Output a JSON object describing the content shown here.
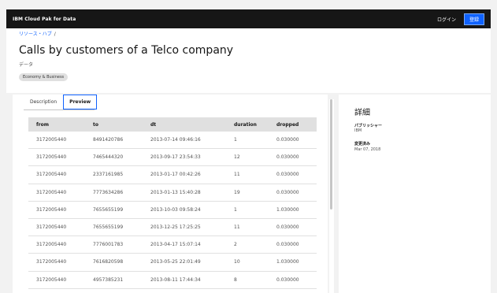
{
  "header": {
    "brand": "IBM Cloud Pak for Data",
    "login": "ログイン",
    "register": "登録"
  },
  "breadcrumb": {
    "hub": "リソース・ハブ",
    "separator": "/"
  },
  "asset": {
    "title": "Calls by customers of a Telco company",
    "type": "データ",
    "tag": "Economy & Business"
  },
  "tabs": [
    {
      "label": "Description",
      "selected": false
    },
    {
      "label": "Preview",
      "selected": true
    }
  ],
  "table": {
    "columns": [
      "from",
      "to",
      "dt",
      "duration",
      "dropped"
    ],
    "rows": [
      [
        "3172005440",
        "8491420786",
        "2013-07-14 09:46:16",
        "1",
        "0.030000"
      ],
      [
        "3172005440",
        "7465444320",
        "2013-09-17 23:54:33",
        "12",
        "0.030000"
      ],
      [
        "3172005440",
        "2337161985",
        "2013-01-17 00:42:26",
        "11",
        "0.030000"
      ],
      [
        "3172005440",
        "7773634286",
        "2013-01-13 15:40:28",
        "19",
        "0.030000"
      ],
      [
        "3172005440",
        "7655655199",
        "2013-10-03 09:58:24",
        "1",
        "1.030000"
      ],
      [
        "3172005440",
        "7655655199",
        "2013-12-25 17:25:25",
        "11",
        "0.030000"
      ],
      [
        "3172005440",
        "7776001783",
        "2013-04-17 15:07:14",
        "2",
        "0.030000"
      ],
      [
        "3172005440",
        "7616820598",
        "2013-05-25 22:01:49",
        "10",
        "1.030000"
      ],
      [
        "3172005440",
        "4957385231",
        "2013-08-11 17:44:34",
        "8",
        "0.030000"
      ]
    ]
  },
  "details": {
    "title": "詳細",
    "publisher_label": "パブリッシャー",
    "publisher_value": "IBM",
    "modified_label": "変更済み",
    "modified_value": "Mar 07, 2018"
  },
  "colors": {
    "topbar": "#161616",
    "accent": "#0f62fe"
  }
}
